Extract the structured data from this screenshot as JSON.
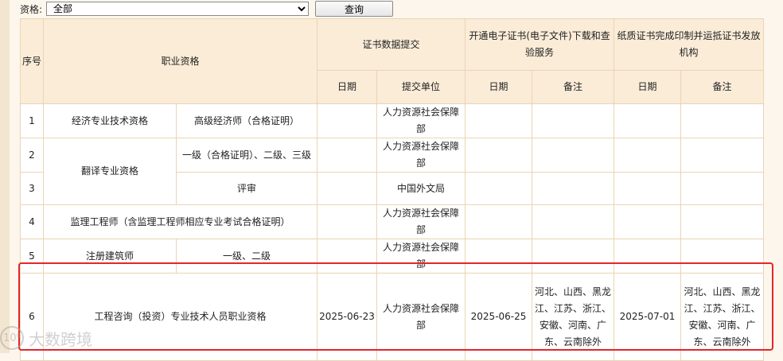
{
  "filter": {
    "label": "资格:",
    "selected": "全部",
    "query_button": "查询"
  },
  "header": {
    "seq": "序号",
    "qualification": "职业资格",
    "cert_submit": "证书数据提交",
    "e_cert": "开通电子证书(电子文件)下载和查验服务",
    "paper_cert": "纸质证书完成印制并运抵证书发放机构",
    "date": "日期",
    "submit_unit": "提交单位",
    "note": "备注"
  },
  "rows": [
    {
      "seq": "1",
      "qual": "经济专业技术资格",
      "sub": "高级经济师（合格证明）",
      "submit_date": "",
      "unit": "人力资源社会保障部",
      "e_date": "",
      "e_note": "",
      "p_date": "",
      "p_note": ""
    },
    {
      "seq": "2",
      "qual": "翻译专业资格",
      "sub": "一级（合格证明）、二级、三级",
      "submit_date": "",
      "unit": "人力资源社会保障部",
      "e_date": "",
      "e_note": "",
      "p_date": "",
      "p_note": ""
    },
    {
      "seq": "3",
      "sub": "评审",
      "submit_date": "",
      "unit": "中国外文局",
      "e_date": "",
      "e_note": "",
      "p_date": "",
      "p_note": ""
    },
    {
      "seq": "4",
      "qual": "监理工程师（含监理工程师相应专业考试合格证明）",
      "submit_date": "",
      "unit": "人力资源社会保障部",
      "e_date": "",
      "e_note": "",
      "p_date": "",
      "p_note": ""
    },
    {
      "seq": "5",
      "qual": "注册建筑师",
      "sub": "一级、二级",
      "submit_date": "",
      "unit": "人力资源社会保障部",
      "e_date": "",
      "e_note": "",
      "p_date": "",
      "p_note": ""
    },
    {
      "seq": "6",
      "qual": "工程咨询（投资）专业技术人员职业资格",
      "submit_date": "2025-06-23",
      "unit": "人力资源社会保障部",
      "e_date": "2025-06-25",
      "e_note": "河北、山西、黑龙江、江苏、浙江、安徽、河南、广东、云南除外",
      "p_date": "2025-07-01",
      "p_note": "河北、山西、黑龙江、江苏、浙江、安徽、河南、广东、云南除外"
    }
  ],
  "watermark": {
    "logo": "10⁰",
    "text": "大数跨境"
  },
  "colors": {
    "header_bg": "#fbecd8",
    "border": "#ead4b4",
    "highlight": "#e3262a",
    "page_bg": "#fdf6ec"
  }
}
